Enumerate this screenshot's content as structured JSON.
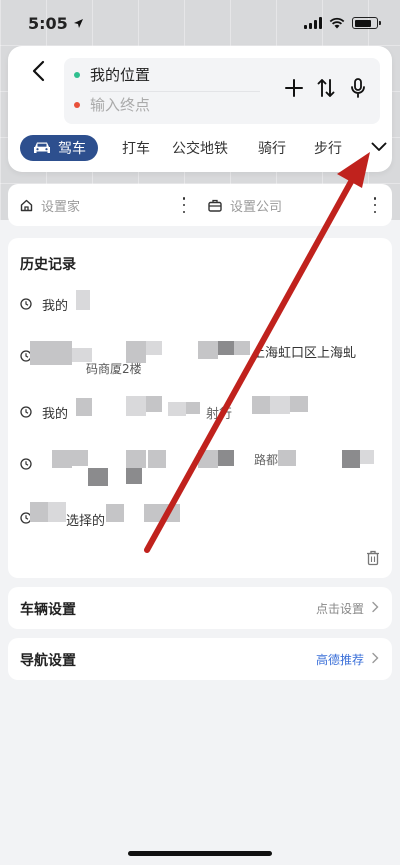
{
  "status_bar": {
    "time": "5:05"
  },
  "route": {
    "start_label": "我的位置",
    "end_placeholder": "输入终点"
  },
  "modes": {
    "items": [
      "驾车",
      "打车",
      "公交地铁",
      "骑行",
      "步行"
    ],
    "active": "驾车"
  },
  "places": {
    "home_label": "设置家",
    "company_label": "设置公司"
  },
  "history": {
    "title": "历史记录",
    "items": [
      {
        "text": "我的"
      },
      {
        "text": "码商厦2楼",
        "text_b": "上海虹口区上海虬"
      },
      {
        "text": "我的",
        "text_b": "射行"
      },
      {
        "text": "",
        "text_b": "路都"
      },
      {
        "text": "选择的"
      }
    ]
  },
  "settings": {
    "vehicle": {
      "title": "车辆设置",
      "value": "点击设置"
    },
    "navigation": {
      "title": "导航设置",
      "value": "高德推荐"
    }
  },
  "colors": {
    "active_tab": "#2d4f8e",
    "start_dot": "#2fbf8f",
    "end_dot": "#e8503a",
    "link_blue": "#3a6fd8",
    "annotation_arrow": "#c0221d"
  },
  "icons": {
    "back": "chevron-left-icon",
    "add": "plus-icon",
    "swap": "swap-vertical-icon",
    "voice": "microphone-icon",
    "expand": "chevron-down-icon",
    "home": "home-icon",
    "company": "briefcase-icon",
    "history_item": "clock-icon",
    "delete": "trash-icon"
  }
}
